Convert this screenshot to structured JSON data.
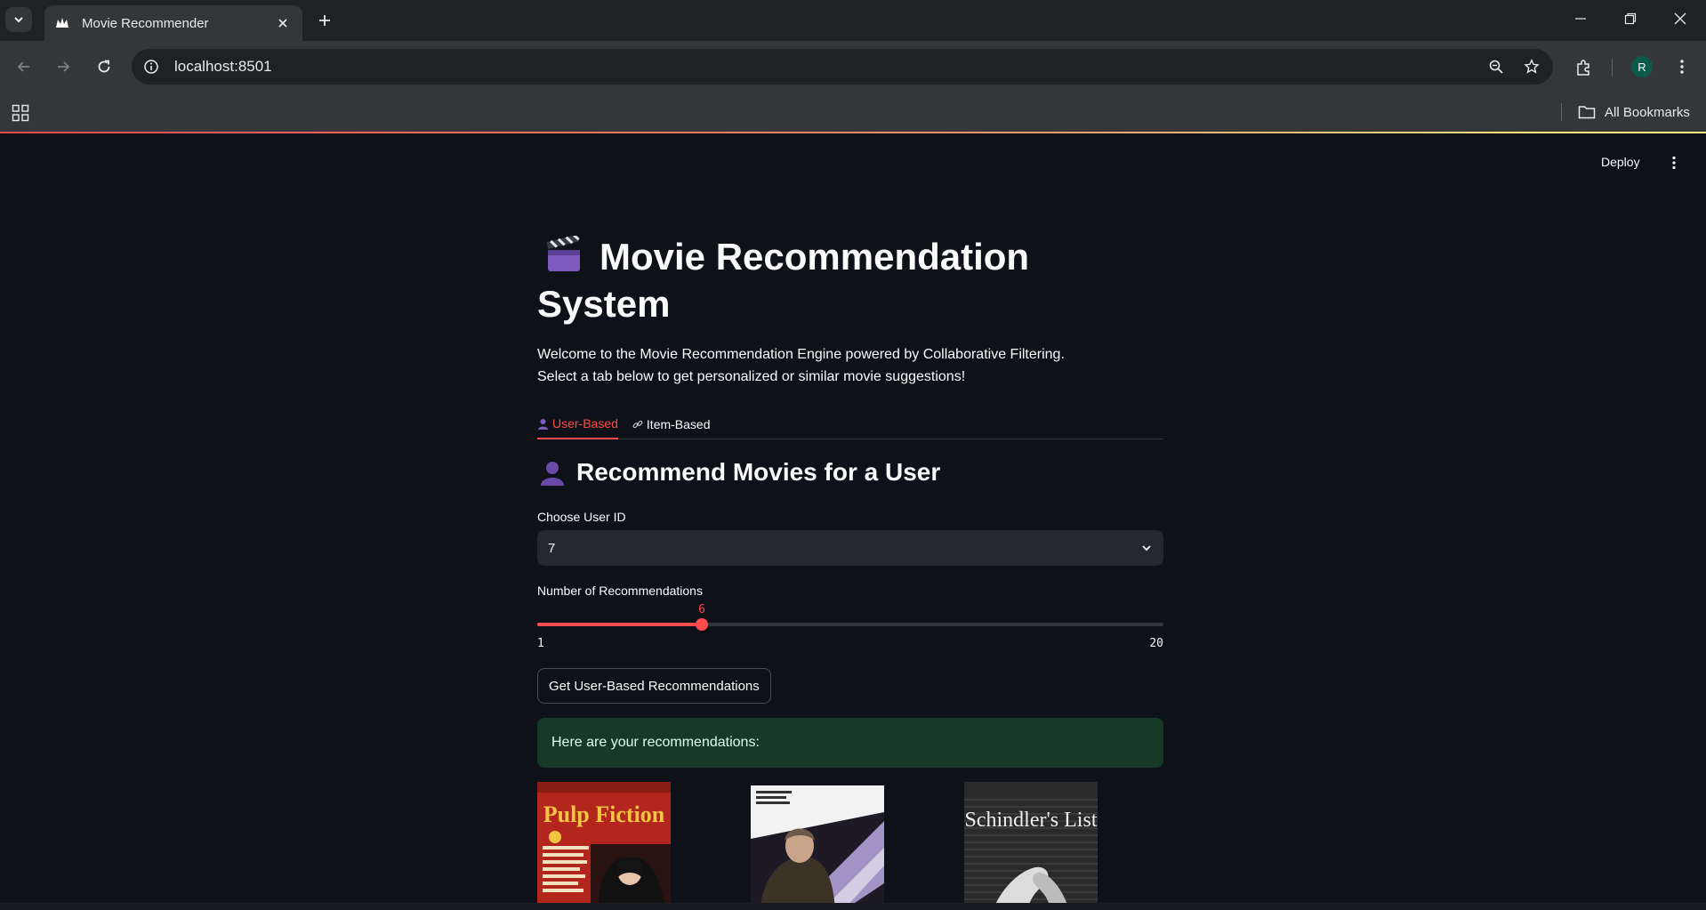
{
  "browser": {
    "tab_title": "Movie Recommender",
    "url": "localhost:8501",
    "bookmarks_label": "All Bookmarks",
    "profile_initial": "R"
  },
  "app": {
    "deploy_label": "Deploy",
    "title": "Movie Recommendation System",
    "intro_line1": "Welcome to the Movie Recommendation Engine powered by Collaborative Filtering.",
    "intro_line2": "Select a tab below to get personalized or similar movie suggestions!",
    "tabs": [
      {
        "label": "User-Based",
        "active": true
      },
      {
        "label": "Item-Based",
        "active": false
      }
    ],
    "section_title": "Recommend Movies for a User",
    "user_select": {
      "label": "Choose User ID",
      "value": "7"
    },
    "num_slider": {
      "label": "Number of Recommendations",
      "min": 1,
      "max": 20,
      "value": 6
    },
    "button_label": "Get User-Based Recommendations",
    "success_message": "Here are your recommendations:",
    "posters": [
      "Pulp Fiction",
      "The Fugitive",
      "Schindler's List"
    ]
  },
  "colors": {
    "accent": "#ff4b4b",
    "background": "#0e1117",
    "success_bg": "#173928"
  }
}
